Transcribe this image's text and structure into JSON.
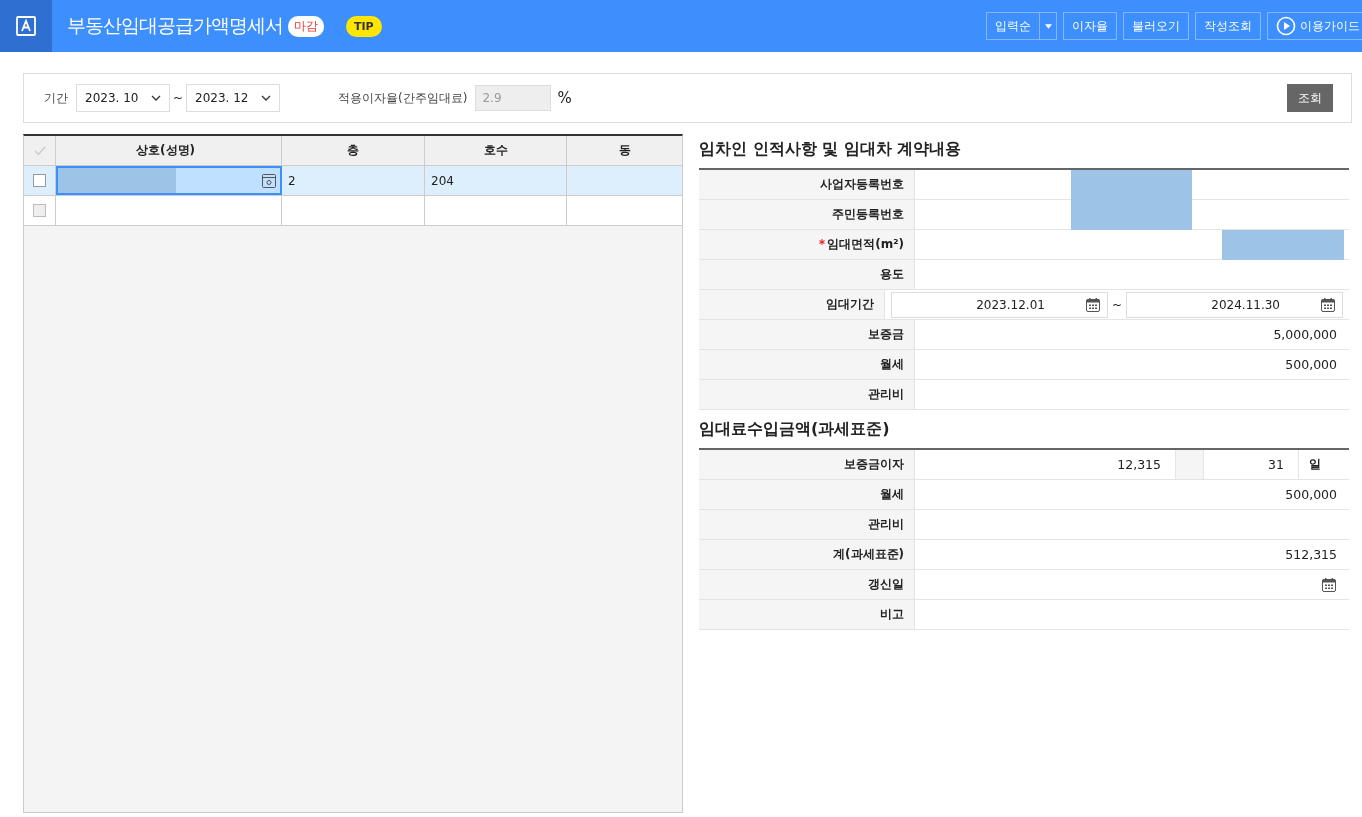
{
  "header": {
    "title": "부동산임대공급가액명세서",
    "status_badge": "마감",
    "tip_badge": "TIP",
    "sort_button": "입력순",
    "buttons": [
      "이자율",
      "불러오기",
      "작성조회"
    ],
    "guide_button": "이용가이드"
  },
  "filter": {
    "period_label": "기간",
    "period_from": "2023. 10",
    "separator": "~",
    "period_to": "2023. 12",
    "rate_label": "적용이자율(간주임대료)",
    "rate_value": "2.9",
    "rate_unit": "%",
    "search_button": "조회"
  },
  "table": {
    "columns": [
      "상호(성명)",
      "층",
      "호수",
      "동"
    ],
    "rows": [
      {
        "selected": true,
        "masked": true,
        "cells": [
          "",
          "2",
          "204",
          ""
        ]
      },
      {
        "selected": false,
        "masked": false,
        "cells": [
          "",
          "",
          "",
          ""
        ]
      }
    ]
  },
  "contract": {
    "title": "임차인 인적사항 및 임대차 계약내용",
    "rows": [
      {
        "kind": "masked_mid",
        "label": "사업자등록번호",
        "required": false
      },
      {
        "kind": "masked_mid",
        "label": "주민등록번호",
        "required": false
      },
      {
        "kind": "masked_end",
        "label": "임대면적(m²)",
        "required": true
      },
      {
        "kind": "text",
        "label": "용도",
        "required": false
      },
      {
        "kind": "daterange",
        "label": "임대기간",
        "required": false,
        "from": "2023.12.01",
        "separator": "~",
        "to": "2024.11.30"
      },
      {
        "kind": "text",
        "label": "보증금",
        "required": false,
        "value": "5,000,000"
      },
      {
        "kind": "text",
        "label": "월세",
        "required": false,
        "value": "500,000"
      },
      {
        "kind": "text",
        "label": "관리비",
        "required": false
      }
    ]
  },
  "income": {
    "title": "임대료수입금액(과세표준)",
    "rows": [
      {
        "kind": "interest",
        "label": "보증금이자",
        "value": "12,315",
        "days": "31",
        "unit": "일"
      },
      {
        "kind": "text",
        "label": "월세",
        "value": "500,000"
      },
      {
        "kind": "text",
        "label": "관리비"
      },
      {
        "kind": "text",
        "label": "계(과세표준)",
        "value": "512,315"
      },
      {
        "kind": "date",
        "label": "갱신일"
      },
      {
        "kind": "text",
        "label": "비고"
      }
    ]
  }
}
